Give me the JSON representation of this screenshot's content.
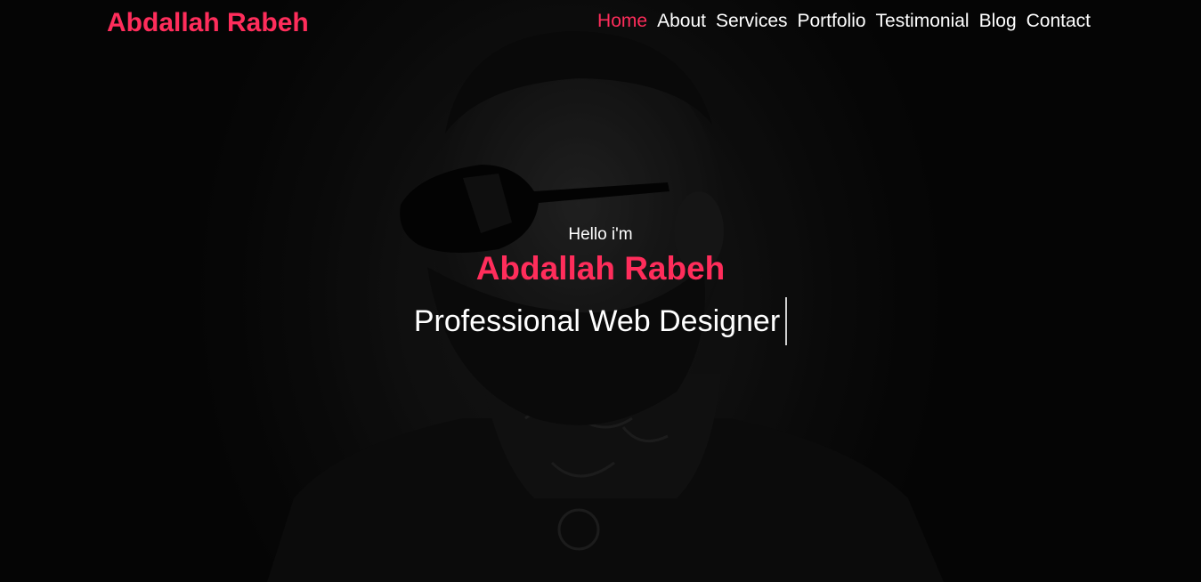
{
  "navbar": {
    "brand": "Abdallah Rabeh",
    "items": [
      {
        "label": "Home",
        "active": true
      },
      {
        "label": "About",
        "active": false
      },
      {
        "label": "Services",
        "active": false
      },
      {
        "label": "Portfolio",
        "active": false
      },
      {
        "label": "Testimonial",
        "active": false
      },
      {
        "label": "Blog",
        "active": false
      },
      {
        "label": "Contact",
        "active": false
      }
    ]
  },
  "hero": {
    "greeting": "Hello i'm",
    "name": "Abdallah Rabeh",
    "role": "Professional Web Designer"
  },
  "colors": {
    "accent": "#ff2d5b",
    "text": "#ffffff",
    "background": "#0b0b0b"
  }
}
